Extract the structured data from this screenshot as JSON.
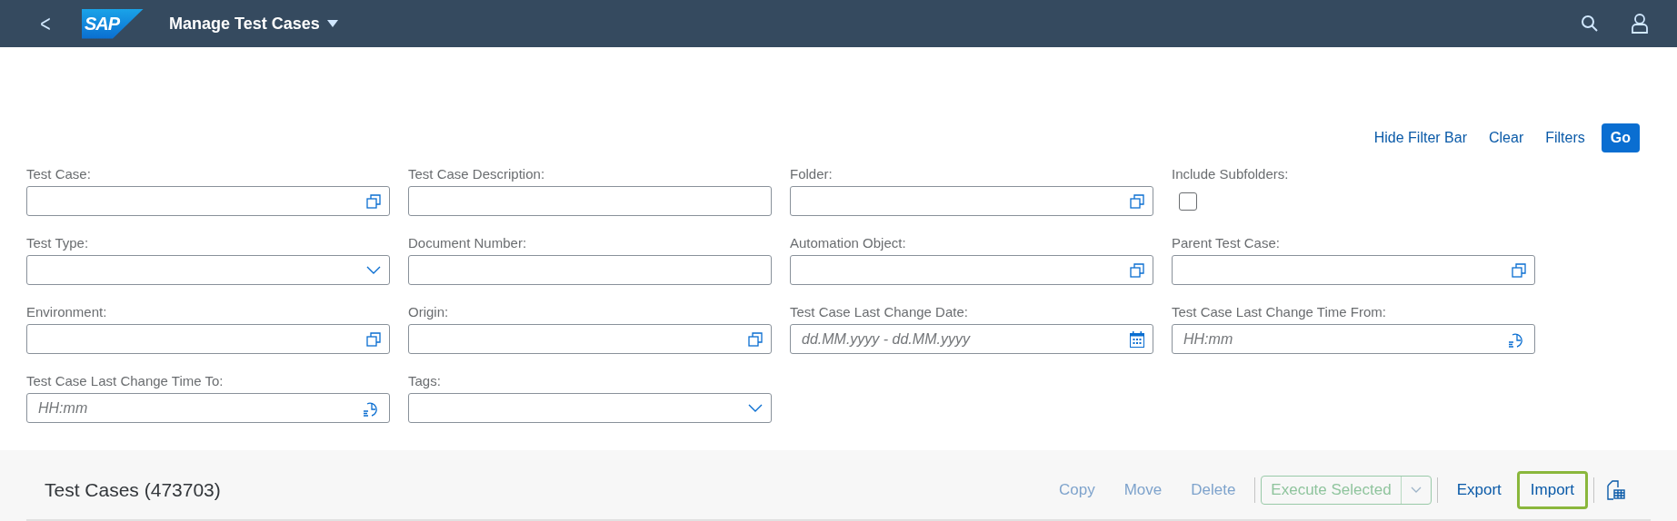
{
  "shell": {
    "back": "<",
    "logo": "SAP",
    "title": "Manage Test Cases"
  },
  "filter_bar": {
    "actions": [
      {
        "label": "Hide Filter Bar",
        "kind": "link"
      },
      {
        "label": "Clear",
        "kind": "link"
      },
      {
        "label": "Filters",
        "kind": "link"
      },
      {
        "label": "Go",
        "kind": "primary"
      }
    ],
    "fields": [
      {
        "label": "Test Case:",
        "kind": "valuehelp"
      },
      {
        "label": "Test Case Description:",
        "kind": "text"
      },
      {
        "label": "Folder:",
        "kind": "valuehelp"
      },
      {
        "label": "Include Subfolders:",
        "kind": "checkbox",
        "checked": false
      },
      {
        "label": "Test Type:",
        "kind": "select"
      },
      {
        "label": "Document Number:",
        "kind": "text"
      },
      {
        "label": "Automation Object:",
        "kind": "valuehelp"
      },
      {
        "label": "Parent Test Case:",
        "kind": "valuehelp"
      },
      {
        "label": "Environment:",
        "kind": "valuehelp"
      },
      {
        "label": "Origin:",
        "kind": "valuehelp"
      },
      {
        "label": "Test Case Last Change Date:",
        "kind": "date",
        "placeholder": "dd.MM.yyyy - dd.MM.yyyy"
      },
      {
        "label": "Test Case Last Change Time From:",
        "kind": "time",
        "placeholder": "HH:mm"
      },
      {
        "label": "Test Case Last Change Time To:",
        "kind": "time",
        "placeholder": "HH:mm"
      },
      {
        "label": "Tags:",
        "kind": "select"
      }
    ]
  },
  "table": {
    "title": "Test Cases (473703)",
    "toolbar": [
      {
        "label": "Copy",
        "kind": "button",
        "disabled": true
      },
      {
        "label": "Move",
        "kind": "button",
        "disabled": true
      },
      {
        "label": "Delete",
        "kind": "button",
        "disabled": true
      },
      {
        "kind": "separator"
      },
      {
        "label": "Execute Selected",
        "kind": "split",
        "disabled": true
      },
      {
        "kind": "separator"
      },
      {
        "label": "Export",
        "kind": "button",
        "disabled": false
      },
      {
        "label": "Import",
        "kind": "button",
        "disabled": false,
        "focused": true
      },
      {
        "kind": "separator"
      },
      {
        "kind": "settings"
      }
    ]
  }
}
